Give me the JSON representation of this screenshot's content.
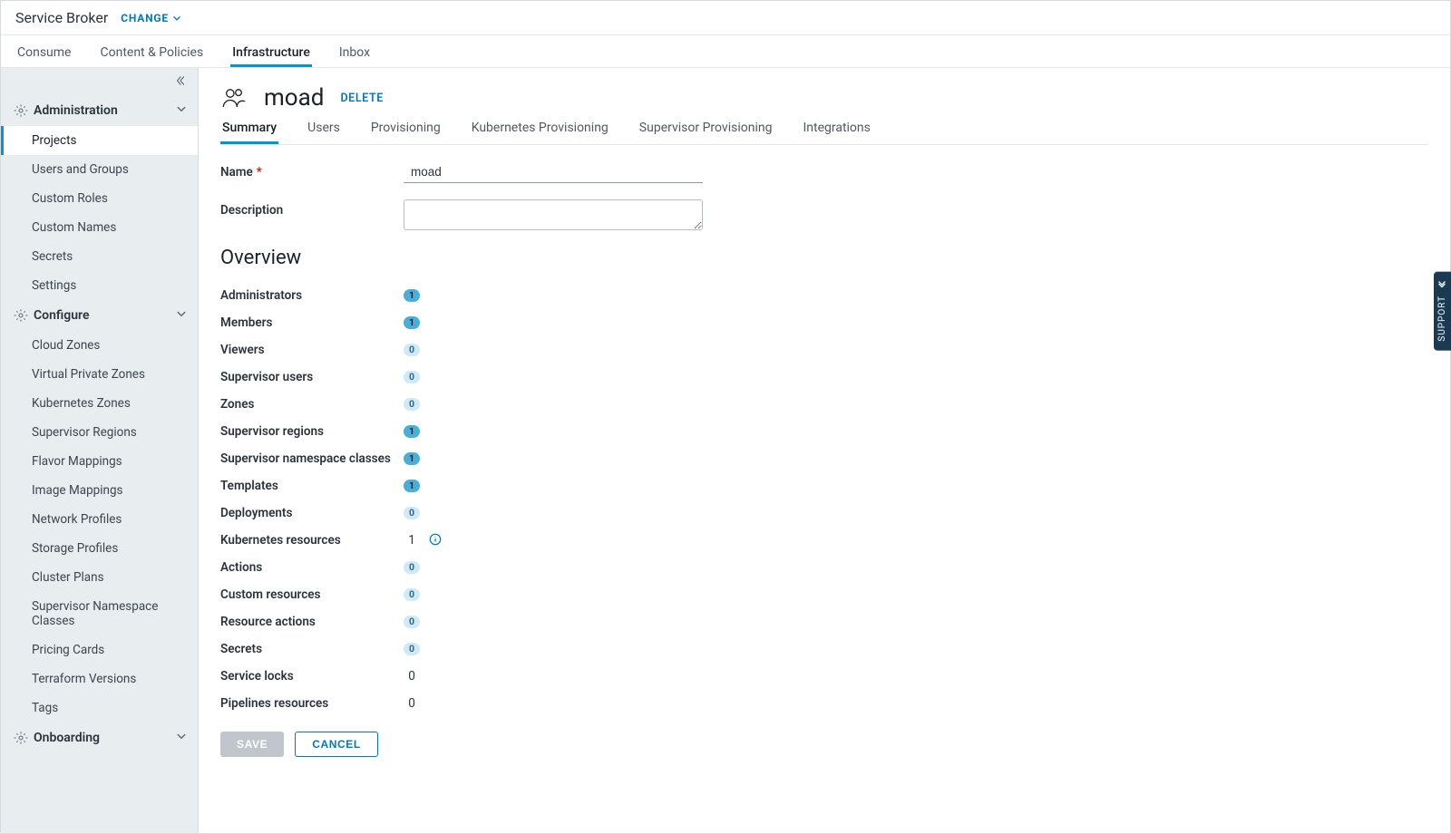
{
  "header": {
    "brand": "Service Broker",
    "change": "CHANGE"
  },
  "top_nav": [
    {
      "label": "Consume",
      "key": "consume",
      "active": false
    },
    {
      "label": "Content & Policies",
      "key": "content-policies",
      "active": false
    },
    {
      "label": "Infrastructure",
      "key": "infrastructure",
      "active": true
    },
    {
      "label": "Inbox",
      "key": "inbox",
      "active": false
    }
  ],
  "sidebar": {
    "sections": [
      {
        "label": "Administration",
        "key": "administration",
        "items": [
          {
            "label": "Projects",
            "key": "projects",
            "active": true
          },
          {
            "label": "Users and Groups",
            "key": "users-groups"
          },
          {
            "label": "Custom Roles",
            "key": "custom-roles"
          },
          {
            "label": "Custom Names",
            "key": "custom-names"
          },
          {
            "label": "Secrets",
            "key": "secrets"
          },
          {
            "label": "Settings",
            "key": "settings"
          }
        ]
      },
      {
        "label": "Configure",
        "key": "configure",
        "items": [
          {
            "label": "Cloud Zones",
            "key": "cloud-zones"
          },
          {
            "label": "Virtual Private Zones",
            "key": "vpz"
          },
          {
            "label": "Kubernetes Zones",
            "key": "k8s-zones"
          },
          {
            "label": "Supervisor Regions",
            "key": "sup-regions"
          },
          {
            "label": "Flavor Mappings",
            "key": "flavor-mappings"
          },
          {
            "label": "Image Mappings",
            "key": "image-mappings"
          },
          {
            "label": "Network Profiles",
            "key": "net-profiles"
          },
          {
            "label": "Storage Profiles",
            "key": "storage-profiles"
          },
          {
            "label": "Cluster Plans",
            "key": "cluster-plans"
          },
          {
            "label": "Supervisor Namespace Classes",
            "key": "sup-ns-classes"
          },
          {
            "label": "Pricing Cards",
            "key": "pricing-cards"
          },
          {
            "label": "Terraform Versions",
            "key": "terraform-versions"
          },
          {
            "label": "Tags",
            "key": "tags"
          }
        ]
      },
      {
        "label": "Onboarding",
        "key": "onboarding",
        "items": []
      }
    ]
  },
  "page": {
    "title": "moad",
    "delete": "DELETE",
    "tabs": [
      {
        "label": "Summary",
        "key": "summary",
        "active": true
      },
      {
        "label": "Users",
        "key": "users"
      },
      {
        "label": "Provisioning",
        "key": "provisioning"
      },
      {
        "label": "Kubernetes Provisioning",
        "key": "k8s-provisioning"
      },
      {
        "label": "Supervisor Provisioning",
        "key": "sup-provisioning"
      },
      {
        "label": "Integrations",
        "key": "integrations"
      }
    ],
    "form": {
      "name_label": "Name",
      "name_value": "moad",
      "description_label": "Description",
      "description_value": ""
    },
    "overview_title": "Overview",
    "overview": [
      {
        "label": "Administrators",
        "value": 1,
        "badge": "highlight"
      },
      {
        "label": "Members",
        "value": 1,
        "badge": "highlight"
      },
      {
        "label": "Viewers",
        "value": 0,
        "badge": "zero"
      },
      {
        "label": "Supervisor users",
        "value": 0,
        "badge": "zero"
      },
      {
        "label": "Zones",
        "value": 0,
        "badge": "zero"
      },
      {
        "label": "Supervisor regions",
        "value": 1,
        "badge": "highlight"
      },
      {
        "label": "Supervisor namespace classes",
        "value": 1,
        "badge": "highlight"
      },
      {
        "label": "Templates",
        "value": 1,
        "badge": "highlight"
      },
      {
        "label": "Deployments",
        "value": 0,
        "badge": "zero"
      },
      {
        "label": "Kubernetes resources",
        "value": 1,
        "badge": "plain",
        "info": true
      },
      {
        "label": "Actions",
        "value": 0,
        "badge": "zero"
      },
      {
        "label": "Custom resources",
        "value": 0,
        "badge": "zero"
      },
      {
        "label": "Resource actions",
        "value": 0,
        "badge": "zero"
      },
      {
        "label": "Secrets",
        "value": 0,
        "badge": "zero"
      },
      {
        "label": "Service locks",
        "value": 0,
        "badge": "plain"
      },
      {
        "label": "Pipelines resources",
        "value": 0,
        "badge": "plain"
      }
    ],
    "buttons": {
      "save": "SAVE",
      "cancel": "CANCEL"
    }
  },
  "support_tab": "SUPPORT"
}
